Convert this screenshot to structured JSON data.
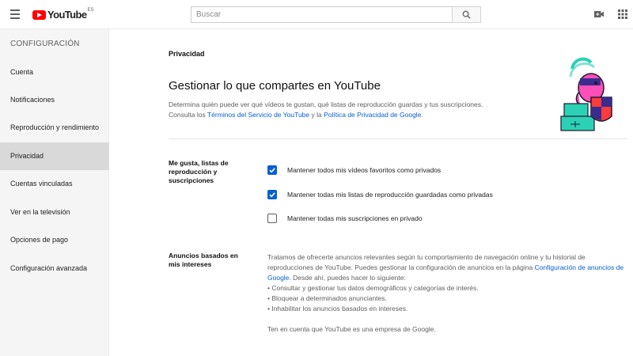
{
  "header": {
    "logo_text": "YouTube",
    "logo_region": "ES",
    "search_placeholder": "Buscar",
    "icons": [
      "menu-icon",
      "search-icon",
      "video-camera-icon",
      "apps-grid-icon"
    ]
  },
  "sidebar": {
    "title": "CONFIGURACIÓN",
    "items": [
      {
        "label": "Cuenta",
        "active": false
      },
      {
        "label": "Notificaciones",
        "active": false
      },
      {
        "label": "Reproducción y rendimiento",
        "active": false
      },
      {
        "label": "Privacidad",
        "active": true
      },
      {
        "label": "Cuentas vinculadas",
        "active": false
      },
      {
        "label": "Ver en la televisión",
        "active": false
      },
      {
        "label": "Opciones de pago",
        "active": false
      },
      {
        "label": "Configuración avanzada",
        "active": false
      }
    ]
  },
  "main": {
    "breadcrumb": "Privacidad",
    "headline": "Gestionar lo que compartes en YouTube",
    "intro_line1": "Determina quién puede ver qué vídeos te gustan, qué listas de reproducción guardas y tus suscripciones.",
    "intro_line2_prefix": "Consulta los ",
    "terms_link": "Términos del Servicio de YouTube",
    "intro_line2_mid": " y la ",
    "privacy_link": "Política de Privacidad de Google",
    "intro_line2_suffix": ".",
    "likes_section": {
      "label": "Me gusta, listas de reproducción y suscripciones",
      "options": [
        {
          "label": "Mantener todos mis vídeos favoritos como privados",
          "checked": true
        },
        {
          "label": "Mantener todas mis listas de reproducción guardadas como privadas",
          "checked": true
        },
        {
          "label": "Mantener todas mis suscripciones en privado",
          "checked": false
        }
      ]
    },
    "ads_section": {
      "label": "Anuncios basados en mis intereses",
      "para_prefix": "Tratamos de ofrecerte anuncios relevantes según tu comportamiento de navegación online y tu historial de reproducciones de YouTube. Puedes gestionar la configuración de anuncios en la página ",
      "ads_link": "Configuración de anuncios de Google",
      "para_suffix": ". Desde ahí, puedes hacer lo siguiente:",
      "bullets": [
        "• Consultar y gestionar tus datos demográficos y categorías de interés.",
        "• Bloquear a determinados anunciantes.",
        "• Inhabilitar los anuncios basados en intereses."
      ],
      "note": "Ten en cuenta que YouTube es una empresa de Google."
    },
    "colors": {
      "accent_blue": "#065fd4",
      "brand_red": "#ff0000",
      "active_item_bg": "#d9d9d9"
    }
  }
}
